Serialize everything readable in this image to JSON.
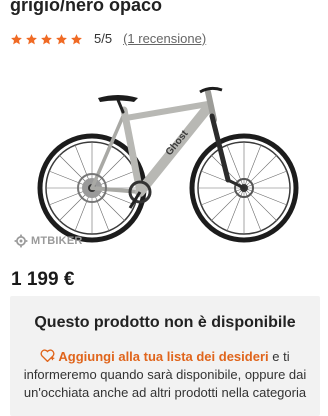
{
  "product": {
    "title": "grigio/nero opaco",
    "rating": {
      "stars": 5,
      "max": 5,
      "score_text": "5/5",
      "reviews_text": "(1 recensione)",
      "star_color": "#f06a24"
    },
    "image": {
      "watermark": "MTBIKER",
      "frame_brand": "Ghost",
      "frame_color": "#b8b8b4"
    },
    "price": "1 199 €"
  },
  "availability": {
    "title": "Questo prodotto non è disponibile",
    "wishlist_link": "Aggiungi alla tua lista dei desideri",
    "message_rest": " e ti informeremo quando sarà disponibile, oppure dai un'occhiata anche ad altri prodotti nella",
    "message_cut": "categoria",
    "accent_color": "#e0651c"
  }
}
